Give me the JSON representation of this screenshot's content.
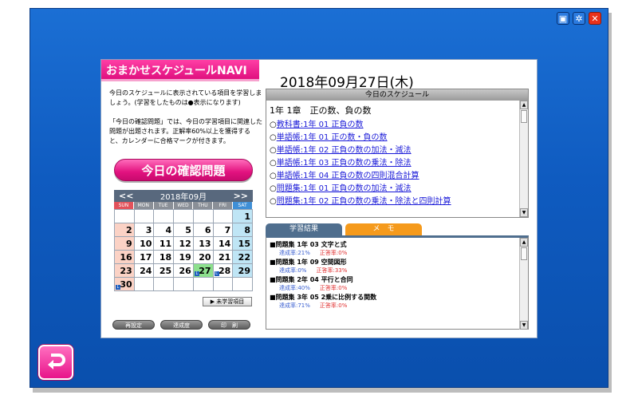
{
  "window": {
    "icons": {
      "cube": "cube-icon",
      "settings": "gear-icon",
      "close": "close-icon"
    }
  },
  "app_title": "おまかせスケジュールNAVI",
  "description": {
    "p1": "今日のスケジュールに表示されている項目を学習しましょう。(学習をしたものは●表示になります)",
    "p2": "「今日の確認問題」では、今日の学習項目に関連した問題が出題されます。正解率60%以上を獲得すると、カレンダーに合格マークが付きます。"
  },
  "kakunin_button": "今日の確認問題",
  "calendar": {
    "prev": "<<",
    "next": ">>",
    "month_label": "2018年09月",
    "dow": [
      "SUN",
      "MON",
      "TUE",
      "WED",
      "THU",
      "FRI",
      "SAT"
    ],
    "days": [
      "",
      "",
      "",
      "",
      "",
      "",
      "1",
      "2",
      "3",
      "4",
      "5",
      "6",
      "7",
      "8",
      "9",
      "10",
      "11",
      "12",
      "13",
      "14",
      "15",
      "16",
      "17",
      "18",
      "19",
      "20",
      "21",
      "22",
      "23",
      "24",
      "25",
      "26",
      "27",
      "28",
      "29",
      "30",
      "",
      "",
      "",
      "",
      "",
      ""
    ],
    "today": "27",
    "marked_days": [
      "27",
      "28",
      "30"
    ]
  },
  "mi_button": "▶ 未学習項目",
  "bottom_buttons": [
    "再設定",
    "達成度",
    "印　刷"
  ],
  "date": "2018年09月27日(木)",
  "schedule": {
    "header": "今日のスケジュール",
    "chapter": "1年 1章　正の数、負の数",
    "items": [
      "教科書:1年 01 正負の数",
      "単語帳:1年 01 正の数・負の数",
      "単語帳:1年 02 正負の数の加法・減法",
      "単語帳:1年 03 正負の数の乗法・除法",
      "単語帳:1年 04 正負の数の四則混合計算",
      "問題集:1年 01 正負の数の加法・減法",
      "問題集:1年 02 正負の数の乗法・除法と四則計算"
    ]
  },
  "tabs": {
    "results": "学習結果",
    "memo": "メ　モ"
  },
  "results": [
    {
      "title": "■問題集 1年 03 文字と式",
      "achievement": "達成率:21%",
      "correct": "正答率:0%"
    },
    {
      "title": "■問題集 1年 09 空間図形",
      "achievement": "達成率:0%",
      "correct": "正答率:33%"
    },
    {
      "title": "■問題集 2年 04 平行と合同",
      "achievement": "達成率:40%",
      "correct": "正答率:0%"
    },
    {
      "title": "■問題集 3年 05 2乗に比例する関数",
      "achievement": "達成率:71%",
      "correct": "正答率:0%"
    }
  ]
}
